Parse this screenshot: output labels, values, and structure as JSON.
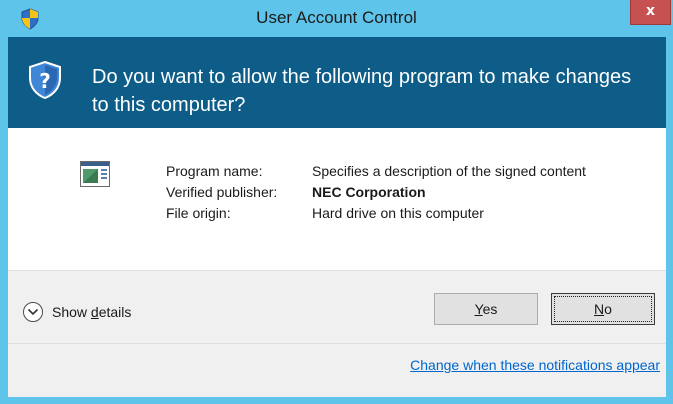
{
  "window": {
    "title": "User Account Control",
    "close_label": "x"
  },
  "banner": {
    "question": "Do you want to allow the following program to make changes to this computer?"
  },
  "program": {
    "icon": "program-window-icon",
    "fields": [
      {
        "label": "Program name:",
        "value": "Specifies a description of the signed content"
      },
      {
        "label": "Verified publisher:",
        "value": "NEC Corporation"
      },
      {
        "label": "File origin:",
        "value": "Hard drive on this computer"
      }
    ]
  },
  "footer": {
    "details_pre": "Show ",
    "details_mnemonic": "d",
    "details_post": "etails",
    "yes_mnemonic": "Y",
    "yes_rest": "es",
    "no_mnemonic": "N",
    "no_rest": "o",
    "change_link": "Change when these notifications appear"
  },
  "colors": {
    "titlebar": "#5ec4ea",
    "banner": "#0d5d88",
    "close_button": "#c75050",
    "link": "#0066cc",
    "footer": "#f0f0f0"
  }
}
